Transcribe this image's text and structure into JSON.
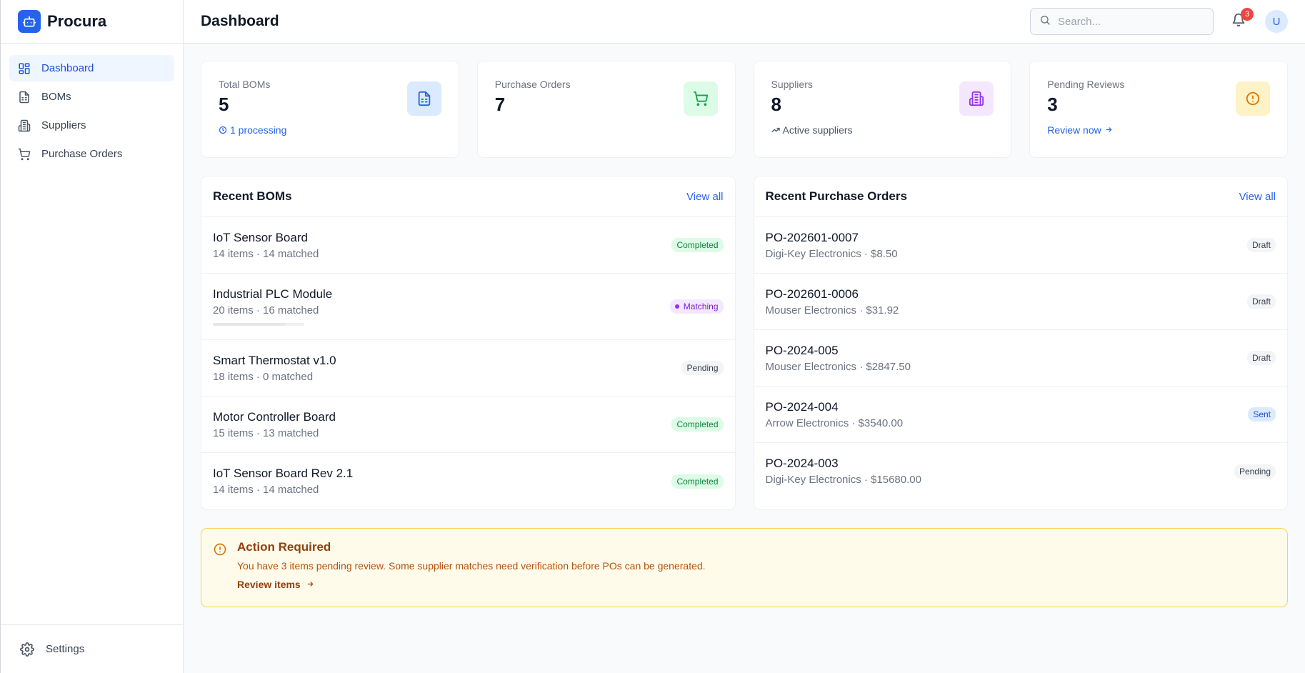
{
  "brand": {
    "name": "Procura"
  },
  "sidebar": {
    "items": [
      {
        "label": "Dashboard",
        "icon": "dashboard-icon",
        "active": true
      },
      {
        "label": "BOMs",
        "icon": "document-icon"
      },
      {
        "label": "Suppliers",
        "icon": "building-icon"
      },
      {
        "label": "Purchase Orders",
        "icon": "cart-icon"
      }
    ],
    "settings_label": "Settings"
  },
  "header": {
    "title": "Dashboard",
    "search_placeholder": "Search...",
    "notification_count": "3",
    "avatar_initial": "U"
  },
  "stats": [
    {
      "label": "Total BOMs",
      "value": "5",
      "sub": "1 processing",
      "icon": "document-icon",
      "color": "#dbeafe"
    },
    {
      "label": "Purchase Orders",
      "value": "7",
      "sub": "",
      "icon": "cart-icon",
      "color": "#dcfce7"
    },
    {
      "label": "Suppliers",
      "value": "8",
      "sub": "Active suppliers",
      "icon": "building-icon",
      "color": "#f3e8ff"
    },
    {
      "label": "Pending Reviews",
      "value": "3",
      "sub": "Review now",
      "icon": "alert-icon",
      "color": "#fef3c7"
    }
  ],
  "recent_boms": {
    "title": "Recent BOMs",
    "view_all": "View all",
    "rows": [
      {
        "name": "IoT Sensor Board",
        "meta": "14 items · 14 matched",
        "status": "Completed"
      },
      {
        "name": "Industrial PLC Module",
        "meta": "20 items · 16 matched",
        "status": "Matching",
        "progress": 0.8
      },
      {
        "name": "Smart Thermostat v1.0",
        "meta": "18 items · 0 matched",
        "status": "Pending"
      },
      {
        "name": "Motor Controller Board",
        "meta": "15 items · 13 matched",
        "status": "Completed"
      },
      {
        "name": "IoT Sensor Board Rev 2.1",
        "meta": "14 items · 14 matched",
        "status": "Completed"
      }
    ]
  },
  "recent_pos": {
    "title": "Recent Purchase Orders",
    "view_all": "View all",
    "rows": [
      {
        "id": "PO-202601-0007",
        "meta": "Digi-Key Electronics · $8.50",
        "status": "Draft"
      },
      {
        "id": "PO-202601-0006",
        "meta": "Mouser Electronics · $31.92",
        "status": "Draft"
      },
      {
        "id": "PO-2024-005",
        "meta": "Mouser Electronics · $2847.50",
        "status": "Draft"
      },
      {
        "id": "PO-2024-004",
        "meta": "Arrow Electronics · $3540.00",
        "status": "Sent"
      },
      {
        "id": "PO-2024-003",
        "meta": "Digi-Key Electronics · $15680.00",
        "status": "Pending"
      }
    ]
  },
  "alert": {
    "title": "Action Required",
    "text": "You have 3 items pending review. Some supplier matches need verification before POs can be generated.",
    "link": "Review items"
  },
  "colors": {
    "accent": "#2563eb",
    "warning": "#f59e0b",
    "success": "#15803d"
  }
}
